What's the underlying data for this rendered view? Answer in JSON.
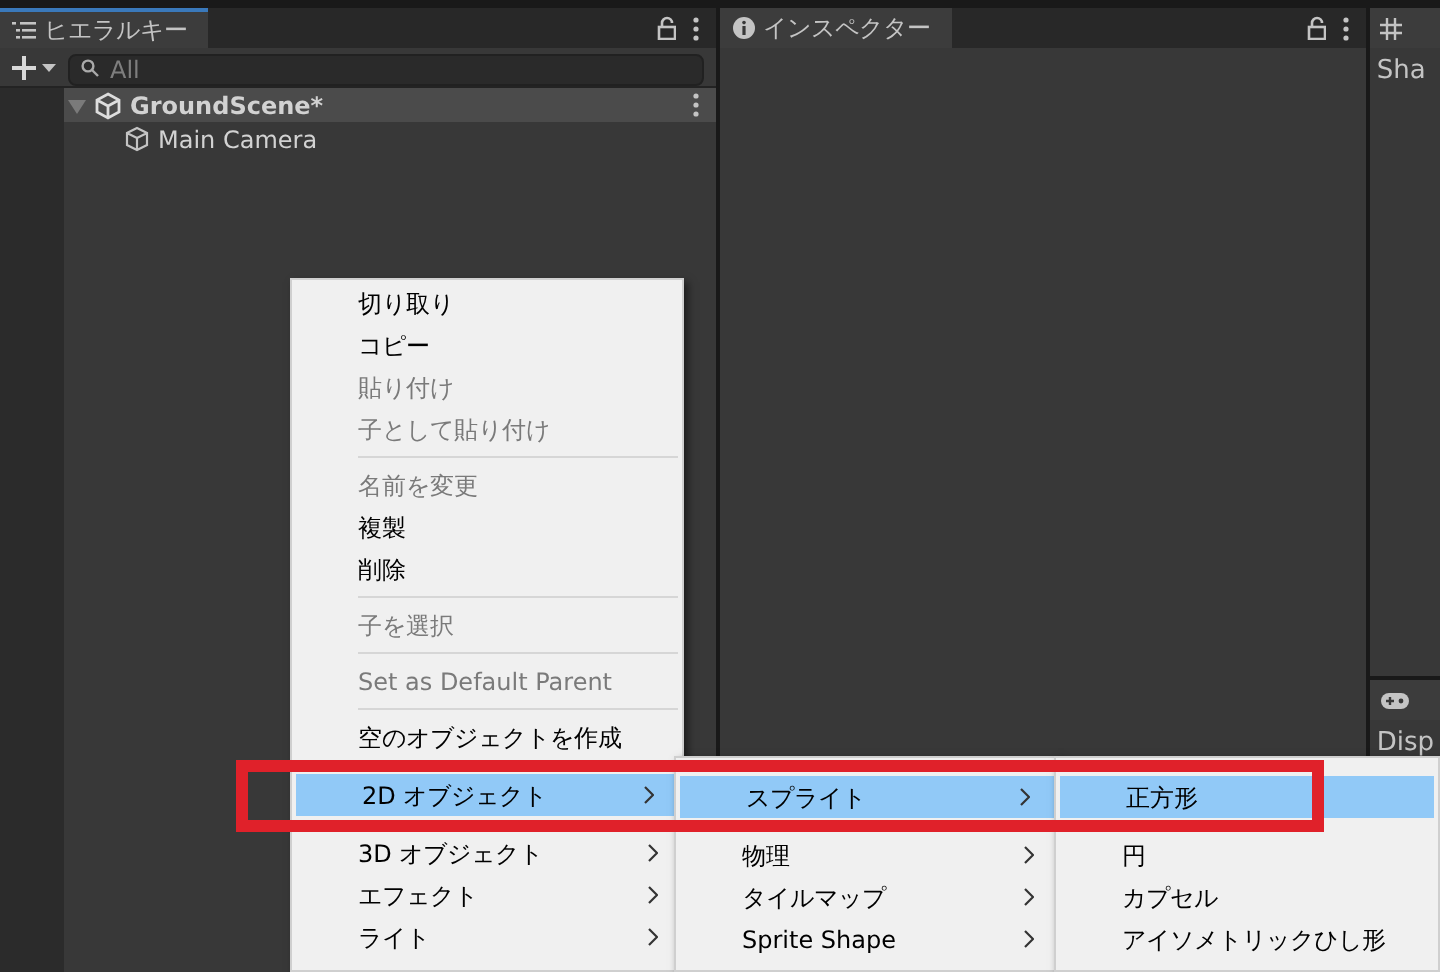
{
  "hierarchy": {
    "tab": {
      "label": "ヒエラルキー",
      "selected": true
    },
    "search": {
      "placeholder": "All"
    },
    "tree": [
      {
        "label": "GroundScene*",
        "kind": "scene",
        "expanded": true,
        "children": [
          {
            "label": "Main Camera",
            "kind": "object"
          }
        ]
      }
    ]
  },
  "inspector": {
    "tab": {
      "label": "インスペクター",
      "selected": true
    }
  },
  "right_panel": {
    "top_text": "Sha",
    "bottom_text": "Disp"
  },
  "context_menu": {
    "items": [
      {
        "kind": "item",
        "label": "切り取り",
        "disabled": false,
        "selected": false,
        "has_submenu": false
      },
      {
        "kind": "item",
        "label": "コピー",
        "disabled": false,
        "selected": false,
        "has_submenu": false
      },
      {
        "kind": "item",
        "label": "貼り付け",
        "disabled": true,
        "selected": false,
        "has_submenu": false
      },
      {
        "kind": "item",
        "label": "子として貼り付け",
        "disabled": true,
        "selected": false,
        "has_submenu": false
      },
      {
        "kind": "separator"
      },
      {
        "kind": "item",
        "label": "名前を変更",
        "disabled": true,
        "selected": false,
        "has_submenu": false
      },
      {
        "kind": "item",
        "label": "複製",
        "disabled": false,
        "selected": false,
        "has_submenu": false
      },
      {
        "kind": "item",
        "label": "削除",
        "disabled": false,
        "selected": false,
        "has_submenu": false
      },
      {
        "kind": "separator"
      },
      {
        "kind": "item",
        "label": "子を選択",
        "disabled": true,
        "selected": false,
        "has_submenu": false
      },
      {
        "kind": "separator"
      },
      {
        "kind": "item",
        "label": "Set as Default Parent",
        "disabled": true,
        "selected": false,
        "has_submenu": false
      },
      {
        "kind": "separator"
      },
      {
        "kind": "item",
        "label": "空のオブジェクトを作成",
        "disabled": false,
        "selected": false,
        "has_submenu": false
      },
      {
        "kind": "item",
        "label": "2D オブジェクト",
        "disabled": false,
        "selected": true,
        "has_submenu": true
      },
      {
        "kind": "item",
        "label": "3D オブジェクト",
        "disabled": false,
        "selected": false,
        "has_submenu": true
      },
      {
        "kind": "item",
        "label": "エフェクト",
        "disabled": false,
        "selected": false,
        "has_submenu": true
      },
      {
        "kind": "item",
        "label": "ライト",
        "disabled": false,
        "selected": false,
        "has_submenu": true
      }
    ]
  },
  "submenu_2d": {
    "items": [
      {
        "kind": "item",
        "label": "スプライト",
        "disabled": false,
        "selected": true,
        "has_submenu": true
      },
      {
        "kind": "item",
        "label": "物理",
        "disabled": false,
        "selected": false,
        "has_submenu": true
      },
      {
        "kind": "item",
        "label": "タイルマップ",
        "disabled": false,
        "selected": false,
        "has_submenu": true
      },
      {
        "kind": "item",
        "label": "Sprite Shape",
        "disabled": false,
        "selected": false,
        "has_submenu": true
      }
    ]
  },
  "submenu_sprite": {
    "items": [
      {
        "kind": "item",
        "label": "正方形",
        "disabled": false,
        "selected": true,
        "has_submenu": false
      },
      {
        "kind": "item",
        "label": "円",
        "disabled": false,
        "selected": false,
        "has_submenu": false
      },
      {
        "kind": "item",
        "label": "カプセル",
        "disabled": false,
        "selected": false,
        "has_submenu": false
      },
      {
        "kind": "item",
        "label": "アイソメトリックひし形",
        "disabled": false,
        "selected": false,
        "has_submenu": false
      }
    ]
  },
  "highlight_frame": {
    "shown": true
  }
}
